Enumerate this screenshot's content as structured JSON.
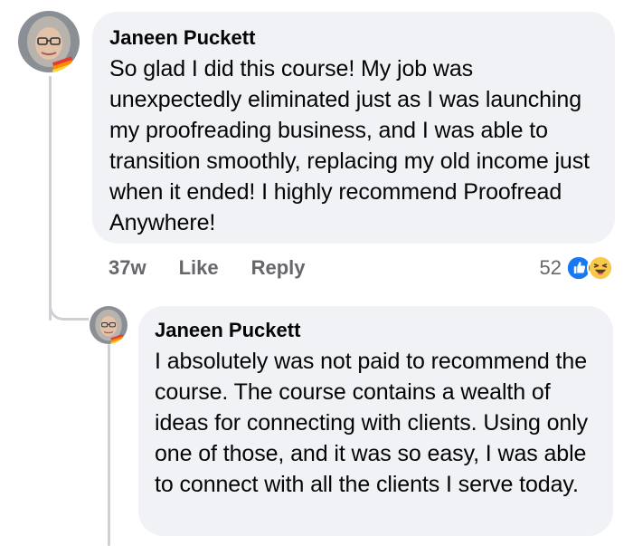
{
  "comment": {
    "author": "Janeen Puckett",
    "text": "So glad I did this course! My job was unexpectedly eliminated just as I was launching my proofreading business, and I was able to transition smoothly, replacing my old income just when it ended! I highly recommend Proofread Anywhere!",
    "time": "37w",
    "like_label": "Like",
    "reply_label": "Reply",
    "reaction_count": "52",
    "reactions": [
      "like-reaction-icon",
      "haha-reaction-icon"
    ]
  },
  "reply": {
    "author": "Janeen Puckett",
    "text": "I absolutely was not paid to recommend the course. The course contains a wealth of ideas for connecting with clients. Using only one of those, and it was so easy, I was able to connect with all the clients I serve today."
  },
  "colors": {
    "bubble": "#f0f2f5",
    "meta_text": "#65676b",
    "like_blue": "#1877f2",
    "haha_yellow": "#f7c94b",
    "thread_line": "#ced0d4"
  }
}
